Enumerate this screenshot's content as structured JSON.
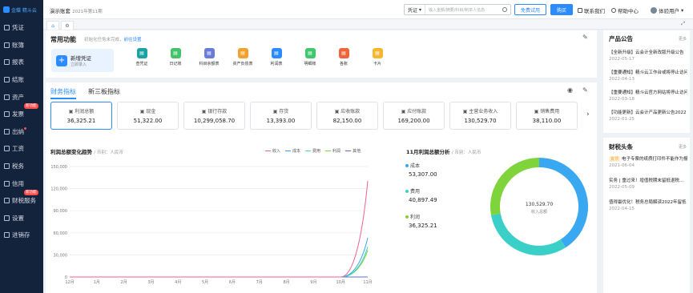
{
  "app": {
    "logo": "金蝶 精斗云",
    "account_name": "演示账套",
    "period": "2021年第11期"
  },
  "sidebar": {
    "items": [
      {
        "label": "凭证",
        "icon": "voucher-icon",
        "badge": ""
      },
      {
        "label": "账簿",
        "icon": "ledger-icon",
        "badge": ""
      },
      {
        "label": "报表",
        "icon": "report-icon",
        "badge": ""
      },
      {
        "label": "结账",
        "icon": "close-book-icon",
        "badge": ""
      },
      {
        "label": "资产",
        "icon": "asset-icon",
        "badge": ""
      },
      {
        "label": "发票",
        "icon": "invoice-icon",
        "badge": "新功能"
      },
      {
        "label": "出纳",
        "icon": "cashier-icon",
        "badge": "dot"
      },
      {
        "label": "工资",
        "icon": "salary-icon",
        "badge": ""
      },
      {
        "label": "税务",
        "icon": "tax-icon",
        "badge": ""
      },
      {
        "label": "信用",
        "icon": "credit-icon",
        "badge": ""
      },
      {
        "label": "财税服务",
        "icon": "service-icon",
        "badge": "新功能"
      },
      {
        "label": "设置",
        "icon": "settings-icon",
        "badge": ""
      },
      {
        "label": "进销存",
        "icon": "inventory-icon",
        "badge": ""
      }
    ]
  },
  "topbar": {
    "search_type": "凭证",
    "search_placeholder": "输入金额/摘要/科目/制单人信息",
    "trial_label": "免费试用",
    "buy_label": "购买",
    "contact_label": "联系我们",
    "help_label": "帮助中心",
    "user_label": "体验用户"
  },
  "quick": {
    "title": "常用功能",
    "subtitle": "初始化任务未完成，",
    "subtitle_link": "前往设置",
    "new_voucher_title": "新增凭证",
    "new_voucher_sub": "立即录入",
    "items": [
      {
        "label": "查凭证",
        "color": "#1aa3a3"
      },
      {
        "label": "日记账",
        "color": "#44c36a"
      },
      {
        "label": "科目余额表",
        "color": "#6b7bd8"
      },
      {
        "label": "资产负债表",
        "color": "#f2a12e"
      },
      {
        "label": "利润表",
        "color": "#2b8cff"
      },
      {
        "label": "明细账",
        "color": "#3ec96c"
      },
      {
        "label": "各账",
        "color": "#f0643c"
      },
      {
        "label": "卡片",
        "color": "#f5b731"
      }
    ]
  },
  "finance": {
    "tab1": "财务指标",
    "tab2": "新三板指标",
    "cards": [
      {
        "label": "利润总额",
        "value": "36,325.21"
      },
      {
        "label": "现金",
        "value": "51,322.00"
      },
      {
        "label": "银行存款",
        "value": "10,299,058.70"
      },
      {
        "label": "存货",
        "value": "13,393.00"
      },
      {
        "label": "应收账款",
        "value": "82,150.00"
      },
      {
        "label": "应付账款",
        "value": "169,200.00"
      },
      {
        "label": "主营业务收入",
        "value": "130,529.70"
      },
      {
        "label": "销售费用",
        "value": "38,110.00"
      }
    ]
  },
  "trend": {
    "title": "利润总额变化趋势",
    "unit": "/ 币别：人民币",
    "legend": [
      {
        "name": "收入",
        "color": "#f0608f"
      },
      {
        "name": "成本",
        "color": "#3aa8f0"
      },
      {
        "name": "费用",
        "color": "#3ad0c8"
      },
      {
        "name": "利润",
        "color": "#7ed43a"
      },
      {
        "name": "其他",
        "color": "#5b6ee0"
      }
    ]
  },
  "chart_data": [
    {
      "type": "line",
      "categories": [
        "12月",
        "1月",
        "2月",
        "3月",
        "4月",
        "5月",
        "6月",
        "7月",
        "8月",
        "9月",
        "10月",
        "11月"
      ],
      "ylim": [
        0,
        150000
      ],
      "yticks": [
        0,
        30000,
        60000,
        90000,
        120000,
        150000
      ],
      "series": [
        {
          "name": "收入",
          "values": [
            0,
            0,
            0,
            0,
            0,
            0,
            0,
            0,
            0,
            0,
            0,
            130529.7
          ]
        },
        {
          "name": "成本",
          "values": [
            0,
            0,
            0,
            0,
            0,
            0,
            0,
            0,
            0,
            0,
            0,
            53307
          ]
        },
        {
          "name": "费用",
          "values": [
            0,
            0,
            0,
            0,
            0,
            0,
            0,
            0,
            0,
            0,
            0,
            40897.49
          ]
        },
        {
          "name": "利润",
          "values": [
            0,
            0,
            0,
            0,
            0,
            0,
            0,
            0,
            0,
            0,
            0,
            36325.21
          ]
        },
        {
          "name": "其他",
          "values": [
            0,
            0,
            0,
            0,
            0,
            0,
            0,
            0,
            0,
            0,
            0,
            0
          ]
        }
      ],
      "grid": true
    },
    {
      "type": "pie",
      "title": "11月利润总额分析",
      "unit": "/ 币别：人民币",
      "center_value": "130,529.70",
      "center_label": "收入总额",
      "slices": [
        {
          "name": "成本",
          "value": 53307.0,
          "label": "53,307.00",
          "color": "#3aa8f0"
        },
        {
          "name": "费用",
          "value": 40897.49,
          "label": "40,897.49",
          "color": "#3ad0c8"
        },
        {
          "name": "利润",
          "value": 36325.21,
          "label": "36,325.21",
          "color": "#7ed43a"
        }
      ]
    }
  ],
  "announcements": {
    "title": "产品公告",
    "more": "更多",
    "items": [
      {
        "title": "【全新升级】云会计全新改版升级公告",
        "date": "2022-05-17"
      },
      {
        "title": "【重要通知】精斗云工作台或将停止访问",
        "date": "2022-04-13"
      },
      {
        "title": "【重要通知】精斗云官方网站将停止访问",
        "date": "2022-03-18"
      },
      {
        "title": "【功能更新】云会计产品更新公告2022",
        "date": "2022-01-25"
      }
    ]
  },
  "headlines": {
    "title": "财税头条",
    "more": "更多",
    "items": [
      {
        "tag": "置顶",
        "title": "电子专票的纸质打印件不能作为报销凭证",
        "date": "2021-06-04"
      },
      {
        "tag": "",
        "title": "实务 | 重过来！增值税期末留抵退税…",
        "date": "2022-05-09"
      },
      {
        "tag": "",
        "title": "值得最优化！税务总局解读2022年留抵",
        "date": "2022-04-15"
      }
    ]
  }
}
